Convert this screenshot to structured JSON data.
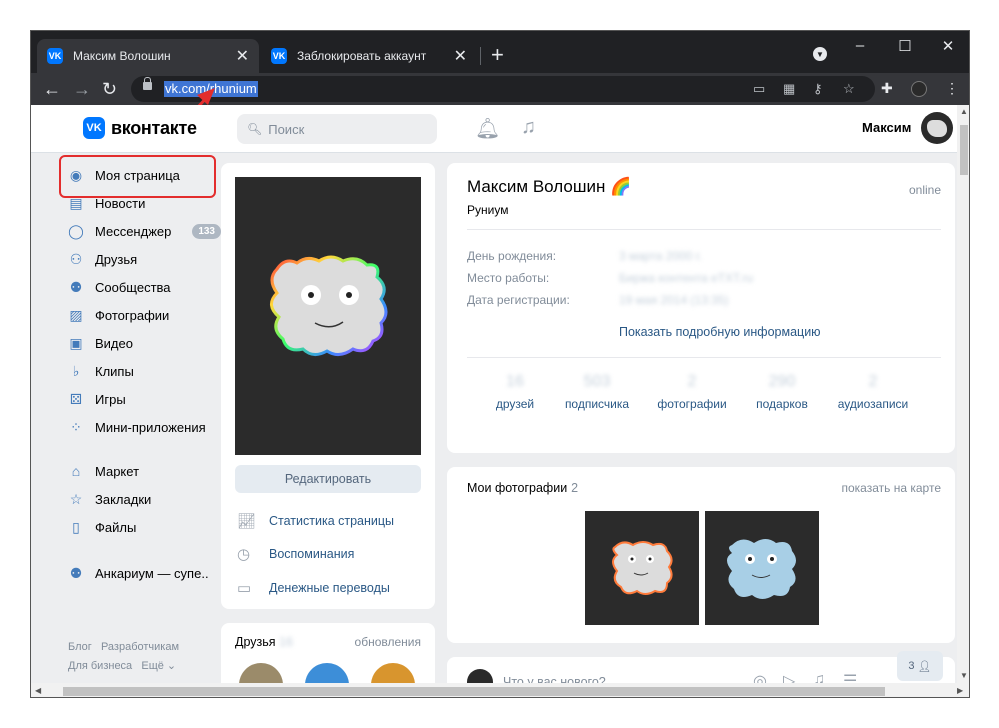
{
  "browser": {
    "tabs": [
      {
        "title": "Максим Волошин",
        "favicon": "VK",
        "active": true
      },
      {
        "title": "Заблокировать аккаунт",
        "favicon": "VK",
        "active": false
      }
    ],
    "url": "vk.com/rhunium",
    "window_controls": {
      "minimize": "–",
      "maximize": "☐",
      "close": "✕"
    }
  },
  "header": {
    "logo_text": "вконтакте",
    "logo_mark": "VK",
    "search_placeholder": "Поиск",
    "user_name": "Максим"
  },
  "sidebar": {
    "items": [
      {
        "label": "Моя страница",
        "icon": "user-icon"
      },
      {
        "label": "Новости",
        "icon": "news-icon"
      },
      {
        "label": "Мессенджер",
        "icon": "chat-icon",
        "badge": "133"
      },
      {
        "label": "Друзья",
        "icon": "friends-icon"
      },
      {
        "label": "Сообщества",
        "icon": "communities-icon"
      },
      {
        "label": "Фотографии",
        "icon": "photos-icon"
      },
      {
        "label": "Видео",
        "icon": "video-icon"
      },
      {
        "label": "Клипы",
        "icon": "clips-icon"
      },
      {
        "label": "Игры",
        "icon": "games-icon"
      },
      {
        "label": "Мини-приложения",
        "icon": "apps-icon"
      },
      {
        "label": "Маркет",
        "icon": "market-icon"
      },
      {
        "label": "Закладки",
        "icon": "bookmarks-icon"
      },
      {
        "label": "Файлы",
        "icon": "files-icon"
      },
      {
        "label": "Анкариум — супе..",
        "icon": "community-icon"
      }
    ],
    "footer": {
      "blog": "Блог",
      "developers": "Разработчикам",
      "business": "Для бизнеса",
      "more": "Ещё ⌄"
    }
  },
  "profile": {
    "name": "Максим Волошин",
    "emoji": "🌈",
    "status": "Руниум",
    "online": "online",
    "info_labels": {
      "birthday": "День рождения:",
      "work": "Место работы:",
      "registered": "Дата регистрации:"
    },
    "info_values": {
      "birthday": "3 марта 2000 г.",
      "work": "Биржа контента eTXT.ru",
      "registered": "19 мая 2014 (13:35)"
    },
    "show_more": "Показать подробную информацию",
    "counters": [
      {
        "num": "16",
        "label": "друзей"
      },
      {
        "num": "503",
        "label": "подписчика"
      },
      {
        "num": "2",
        "label": "фотографии"
      },
      {
        "num": "290",
        "label": "подарков"
      },
      {
        "num": "2",
        "label": "аудиозаписи"
      }
    ]
  },
  "left_column": {
    "edit_button": "Редактировать",
    "actions": [
      {
        "label": "Статистика страницы",
        "icon": "stats-icon"
      },
      {
        "label": "Воспоминания",
        "icon": "memories-icon"
      },
      {
        "label": "Денежные переводы",
        "icon": "money-transfer-icon"
      }
    ],
    "friends_title": "Друзья",
    "friends_count": "16",
    "friends_updates": "обновления"
  },
  "photos": {
    "title": "Мои фотографии",
    "count": "2",
    "map_link": "показать на карте"
  },
  "post": {
    "placeholder": "Что у вас нового?"
  },
  "chat": {
    "count": "3"
  },
  "colors": {
    "vk_blue": "#0077ff",
    "link": "#2a5885",
    "highlight": "#e32d2d"
  }
}
